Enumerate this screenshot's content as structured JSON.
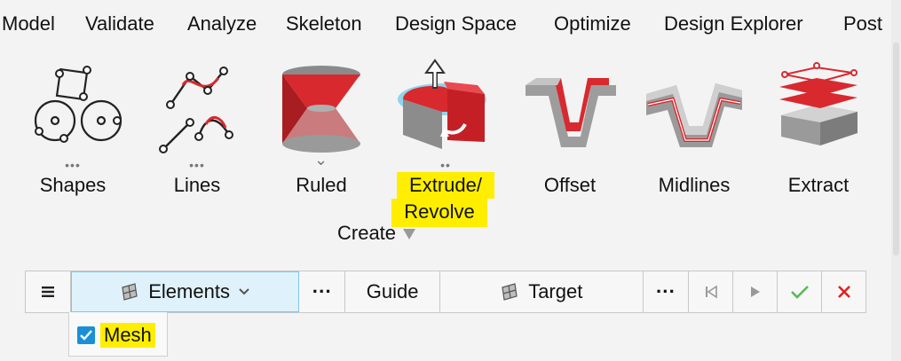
{
  "menu": {
    "items": [
      "Model",
      "Validate",
      "Analyze",
      "Skeleton",
      "Design Space",
      "Optimize",
      "Design Explorer",
      "Post"
    ]
  },
  "ribbon": {
    "tools": [
      {
        "label": "Shapes",
        "more": "•••",
        "icon": "shapes-icon"
      },
      {
        "label": "Lines",
        "more": "•••",
        "icon": "lines-icon"
      },
      {
        "label": "Ruled",
        "more": "⌄",
        "icon": "ruled-icon"
      },
      {
        "label_line1": "Extrude/",
        "label_line2": "Revolve",
        "more": "••",
        "icon": "extrude-revolve-icon",
        "highlighted": true
      },
      {
        "label": "Offset",
        "icon": "offset-icon"
      },
      {
        "label": "Midlines",
        "icon": "midlines-icon"
      },
      {
        "label": "Extract",
        "icon": "extract-icon"
      }
    ],
    "group_label": "Create"
  },
  "toolbar": {
    "menu_icon": "hamburger-icon",
    "elements_label": "Elements",
    "more_label": "···",
    "guide_label": "Guide",
    "target_label": "Target",
    "more2_label": "···"
  },
  "dropdown": {
    "mesh_label": "Mesh",
    "mesh_checked": true
  },
  "colors": {
    "accent_red": "#d8292f",
    "highlight": "#ffee00",
    "active_bg": "#dff2fb",
    "check_green": "#59b956",
    "cancel_red": "#e02020",
    "checkbox_blue": "#1a8fd8"
  }
}
